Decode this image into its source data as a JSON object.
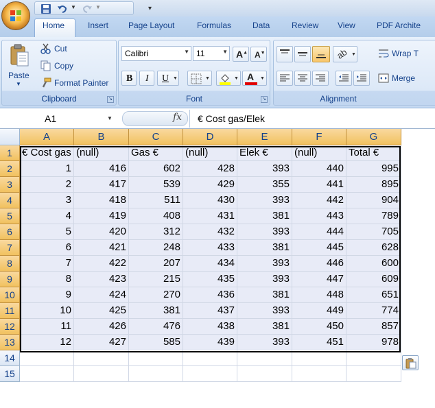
{
  "ribbon": {
    "tabs": [
      "Home",
      "Insert",
      "Page Layout",
      "Formulas",
      "Data",
      "Review",
      "View",
      "PDF Archite"
    ],
    "clipboard": {
      "label": "Clipboard",
      "paste": "Paste",
      "cut": "Cut",
      "copy": "Copy",
      "format_painter": "Format Painter"
    },
    "font": {
      "label": "Font",
      "family": "Calibri",
      "size": "11"
    },
    "alignment": {
      "label": "Alignment",
      "wrap_text": "Wrap T",
      "merge": "Merge"
    }
  },
  "formula_bar": {
    "name_box": "A1",
    "fx": "fx",
    "formula": "€ Cost gas/Elek"
  },
  "sheet": {
    "columns": [
      "A",
      "B",
      "C",
      "D",
      "E",
      "F",
      "G"
    ],
    "rows": [
      "1",
      "2",
      "3",
      "4",
      "5",
      "6",
      "7",
      "8",
      "9",
      "10",
      "11",
      "12",
      "13",
      "14",
      "15"
    ],
    "header_row": [
      "€ Cost gas",
      "(null)",
      "Gas €",
      "(null)",
      "Elek €",
      "(null)",
      "Total €"
    ],
    "data": [
      [
        "1",
        "416",
        "602",
        "428",
        "393",
        "440",
        "995"
      ],
      [
        "2",
        "417",
        "539",
        "429",
        "355",
        "441",
        "895"
      ],
      [
        "3",
        "418",
        "511",
        "430",
        "393",
        "442",
        "904"
      ],
      [
        "4",
        "419",
        "408",
        "431",
        "381",
        "443",
        "789"
      ],
      [
        "5",
        "420",
        "312",
        "432",
        "393",
        "444",
        "705"
      ],
      [
        "6",
        "421",
        "248",
        "433",
        "381",
        "445",
        "628"
      ],
      [
        "7",
        "422",
        "207",
        "434",
        "393",
        "446",
        "600"
      ],
      [
        "8",
        "423",
        "215",
        "435",
        "393",
        "447",
        "609"
      ],
      [
        "9",
        "424",
        "270",
        "436",
        "381",
        "448",
        "651"
      ],
      [
        "10",
        "425",
        "381",
        "437",
        "393",
        "449",
        "774"
      ],
      [
        "11",
        "426",
        "476",
        "438",
        "381",
        "450",
        "857"
      ],
      [
        "12",
        "427",
        "585",
        "439",
        "393",
        "451",
        "978"
      ]
    ]
  },
  "colors": {
    "ribbon_text": "#15428b",
    "selection_fill": "#e8ebf7",
    "header_selected": "#f1c15f"
  },
  "icons": [
    "office-button-icon",
    "save-icon",
    "undo-icon",
    "redo-icon",
    "paste-icon",
    "cut-icon",
    "copy-icon",
    "format-painter-icon",
    "bold-icon",
    "italic-icon",
    "underline-icon",
    "borders-icon",
    "fill-color-icon",
    "font-color-icon",
    "paste-options-icon"
  ]
}
